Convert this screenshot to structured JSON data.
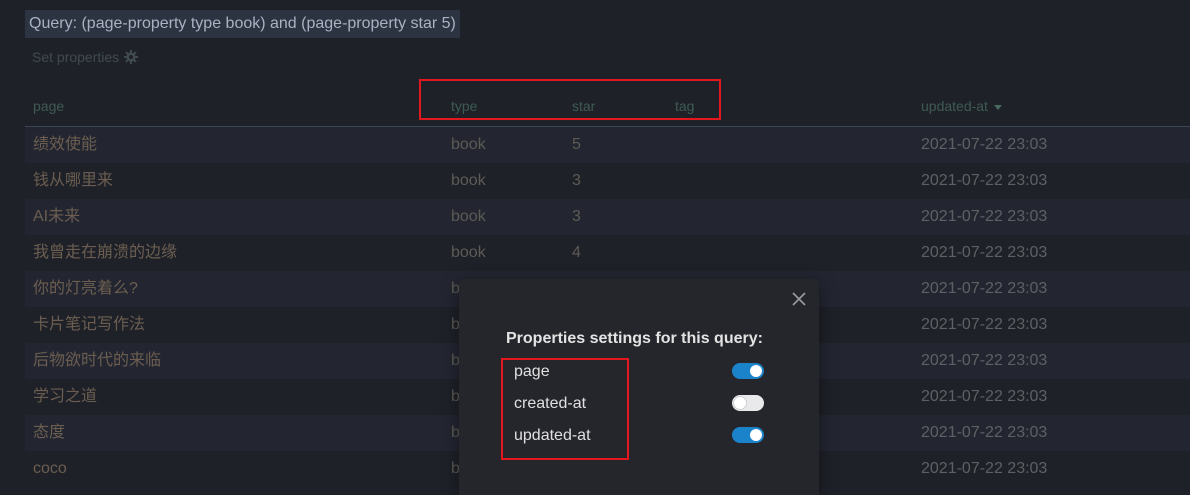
{
  "query": {
    "title": "Query: (page-property type book) and (page-property star 5)",
    "set_properties_label": "Set properties",
    "set_properties_icon": "gear-icon"
  },
  "table": {
    "columns": {
      "page": "page",
      "type": "type",
      "star": "star",
      "tag": "tag",
      "updated_at": "updated-at"
    },
    "sort_icon": "caret-down-icon",
    "rows": [
      {
        "page": "绩效使能",
        "type": "book",
        "star": "5",
        "updated_at": "2021-07-22 23:03"
      },
      {
        "page": "钱从哪里来",
        "type": "book",
        "star": "3",
        "updated_at": "2021-07-22 23:03"
      },
      {
        "page": "AI未来",
        "type": "book",
        "star": "3",
        "updated_at": "2021-07-22 23:03"
      },
      {
        "page": "我曾走在崩溃的边缘",
        "type": "book",
        "star": "4",
        "updated_at": "2021-07-22 23:03"
      },
      {
        "page": "你的灯亮着么?",
        "type": "b",
        "star": "",
        "updated_at": "2021-07-22 23:03"
      },
      {
        "page": "卡片笔记写作法",
        "type": "b",
        "star": "",
        "updated_at": "2021-07-22 23:03"
      },
      {
        "page": "后物欲时代的来临",
        "type": "b",
        "star": "",
        "updated_at": "2021-07-22 23:03"
      },
      {
        "page": "学习之道",
        "type": "b",
        "star": "",
        "updated_at": "2021-07-22 23:03"
      },
      {
        "page": "态度",
        "type": "b",
        "star": "",
        "updated_at": "2021-07-22 23:03"
      },
      {
        "page": "coco",
        "type": "b",
        "star": "",
        "updated_at": "2021-07-22 23:03"
      }
    ]
  },
  "modal": {
    "title": "Properties settings for this query:",
    "close_icon": "close-icon",
    "properties": [
      {
        "label": "page",
        "enabled": true
      },
      {
        "label": "created-at",
        "enabled": false
      },
      {
        "label": "updated-at",
        "enabled": true
      }
    ]
  },
  "colors": {
    "background": "#1f2129",
    "accent": "#1a83c9",
    "annotation": "#e3171e"
  }
}
